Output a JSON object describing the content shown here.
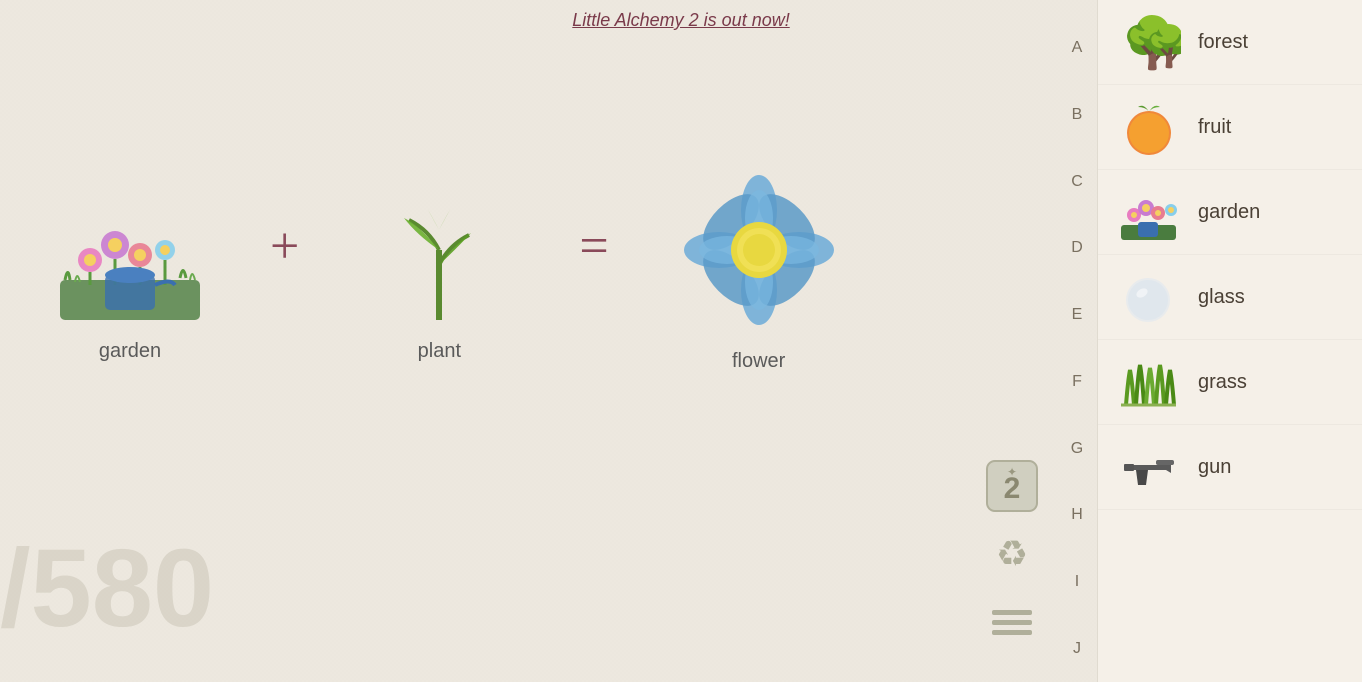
{
  "banner": {
    "text": "Little Alchemy 2 is out now!",
    "link": "Little Alchemy 2 is out now!"
  },
  "equation": {
    "ingredient1": {
      "label": "garden",
      "emoji": "🌸"
    },
    "operator": "+",
    "ingredient2": {
      "label": "plant",
      "emoji": "🌱"
    },
    "equals": "=",
    "result": {
      "label": "flower",
      "emoji": "🌸"
    }
  },
  "score": {
    "display": "/580"
  },
  "alphabet": [
    "A",
    "B",
    "C",
    "D",
    "E",
    "F",
    "G",
    "H",
    "I",
    "J"
  ],
  "elements": [
    {
      "label": "forest",
      "emoji": "🌳"
    },
    {
      "label": "fruit",
      "emoji": "🍊"
    },
    {
      "label": "garden",
      "emoji": "🌸"
    },
    {
      "label": "glass",
      "emoji": "⚪"
    },
    {
      "label": "grass",
      "emoji": "🌿"
    },
    {
      "label": "gun",
      "emoji": "🔫"
    }
  ],
  "sidebar_buttons": {
    "b2_icon": "2",
    "recycle_icon": "♻",
    "menu_icon": "☰"
  }
}
